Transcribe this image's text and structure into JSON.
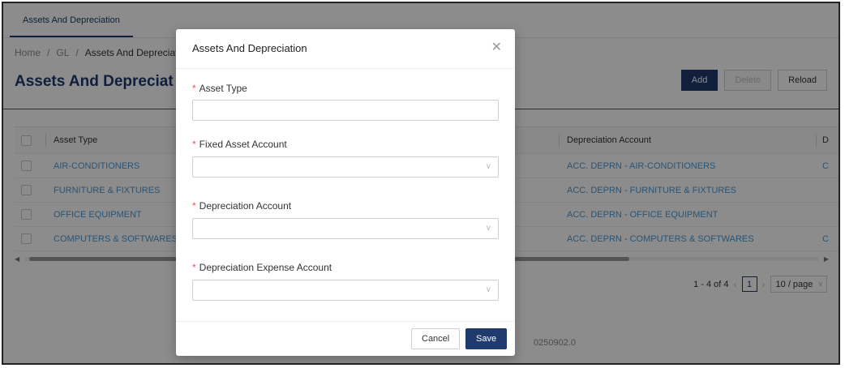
{
  "tab": {
    "label": "Assets And Depreciation"
  },
  "breadcrumb": {
    "home": "Home",
    "sep": "/",
    "gl": "GL",
    "current": "Assets And Depreciat"
  },
  "page_title": "Assets And Depreciat",
  "toolbar": {
    "add": "Add",
    "delete": "Delete",
    "reload": "Reload"
  },
  "table": {
    "headers": {
      "asset_type": "Asset Type",
      "depreciation_account": "Depreciation Account",
      "more": "D"
    },
    "rows": [
      {
        "asset_type": "AIR-CONDITIONERS",
        "depreciation_account": "ACC. DEPRN - AIR-CONDITIONERS",
        "more": "C"
      },
      {
        "asset_type": "FURNITURE & FIXTURES",
        "depreciation_account": "ACC. DEPRN - FURNITURE & FIXTURES",
        "more": ""
      },
      {
        "asset_type": "OFFICE EQUIPMENT",
        "depreciation_account": "ACC. DEPRN - OFFICE EQUIPMENT",
        "more": ""
      },
      {
        "asset_type": "COMPUTERS & SOFTWARES",
        "depreciation_account": "ACC. DEPRN - COMPUTERS & SOFTWARES",
        "more": "C"
      }
    ]
  },
  "pagination": {
    "range": "1 - 4 of 4",
    "current_page": "1",
    "page_size": "10 / page"
  },
  "footer": {
    "version": "0250902.0"
  },
  "modal": {
    "title": "Assets And Depreciation",
    "required_mark": "*",
    "fields": {
      "asset_type": {
        "label": "Asset Type",
        "value": ""
      },
      "fixed_asset_account": {
        "label": "Fixed Asset Account",
        "value": ""
      },
      "depreciation_account": {
        "label": "Depreciation Account",
        "value": ""
      },
      "depreciation_expense_account": {
        "label": "Depreciation Expense Account",
        "value": ""
      }
    },
    "cancel": "Cancel",
    "save": "Save"
  },
  "icons": {
    "close": "close-icon",
    "chevron": "chevron-down-icon"
  },
  "colors": {
    "primary": "#1f3a6e",
    "link": "#4a9ad8",
    "required": "#ff4d4f"
  }
}
